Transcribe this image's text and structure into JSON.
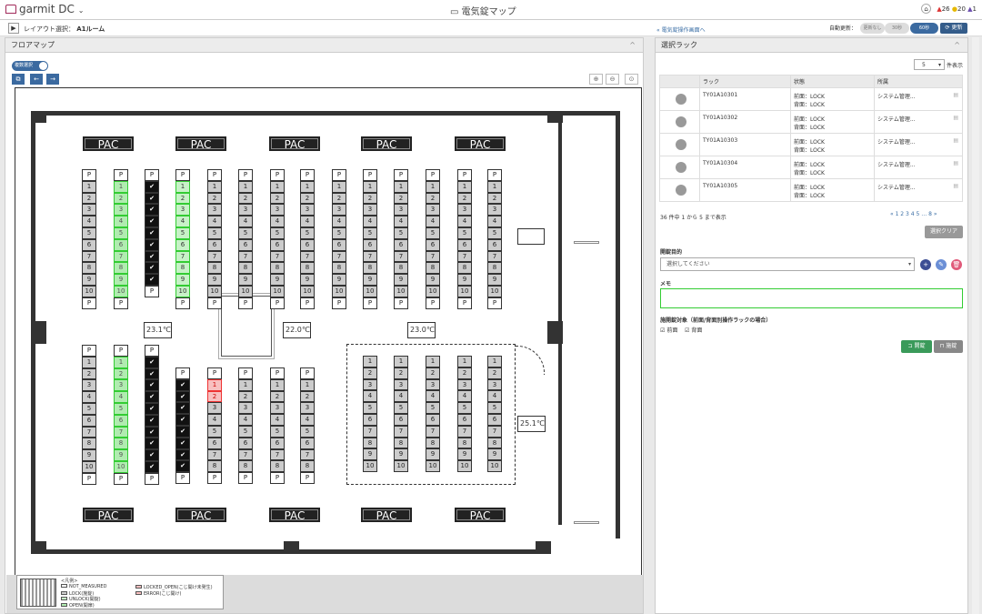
{
  "topbar": {
    "brand": "garmit DC",
    "brand_caret": "⌄",
    "title": "電気錠マップ",
    "home": "⌂",
    "alert_red": "26",
    "alert_yellow": "20",
    "alert_blue": "1"
  },
  "subbar": {
    "play": "▶",
    "layout_label": "レイアウト選択：",
    "layout_value": "A1ルーム",
    "link": "« 電気錠操作画面へ",
    "auto_update_label": "自動更新：",
    "auto_off": "更新なし",
    "auto_30": "30秒",
    "auto_60": "60秒",
    "refresh": "更新"
  },
  "left": {
    "title": "フロアマップ",
    "collapse": "^",
    "multi_select": "複数選択",
    "tool_copy": "⧉",
    "tool_back": "←",
    "tool_fwd": "→",
    "zoom_in": "⊕",
    "zoom_out": "⊖",
    "zoom_fit": "⊙"
  },
  "map": {
    "pac_label": "PAC",
    "p": "P",
    "temps": [
      "23.1℃",
      "22.0℃",
      "23.0℃",
      "25.1℃"
    ]
  },
  "legend": {
    "title": "<凡例>",
    "items": [
      "NOT_MEASURED",
      "LOCK(施錠)",
      "UNLOCK(開錠)",
      "OPEN(開扉)",
      "LOCKED_OPEN(こじ開け未発生)",
      "ERROR(こじ開け)"
    ]
  },
  "right": {
    "title": "選択ラック",
    "collapse": "^",
    "page_size": "5",
    "page_size_suffix": "件表示",
    "cols": [
      "ラック",
      "状態",
      "所属"
    ],
    "rows": [
      {
        "rack": "TY01A10301",
        "front": "前面：LOCK",
        "back": "背面：LOCK",
        "org": "システム管理..."
      },
      {
        "rack": "TY01A10302",
        "front": "前面：LOCK",
        "back": "背面：LOCK",
        "org": "システム管理..."
      },
      {
        "rack": "TY01A10303",
        "front": "前面：LOCK",
        "back": "背面：LOCK",
        "org": "システム管理..."
      },
      {
        "rack": "TY01A10304",
        "front": "前面：LOCK",
        "back": "背面：LOCK",
        "org": "システム管理..."
      },
      {
        "rack": "TY01A10305",
        "front": "前面：LOCK",
        "back": "背面：LOCK",
        "org": "システム管理..."
      }
    ],
    "summary": "36 件中 1 から 5 まで表示",
    "pager": "« 1 2 3 4 5 … 8 »",
    "clear": "選択クリア",
    "purpose_label": "開錠目的",
    "purpose_placeholder": "選択してください",
    "memo_label": "メモ",
    "target_label": "施開錠対象（前面/背面別操作ラックの場合）",
    "front": "前面",
    "back": "背面",
    "unlock": "開錠",
    "lock": "施錠"
  }
}
